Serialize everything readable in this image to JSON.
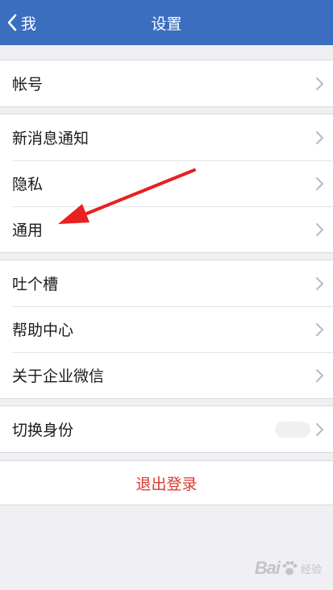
{
  "navbar": {
    "back_label": "我",
    "title": "设置"
  },
  "sections": [
    {
      "items": [
        {
          "label": "帐号"
        }
      ]
    },
    {
      "items": [
        {
          "label": "新消息通知"
        },
        {
          "label": "隐私"
        },
        {
          "label": "通用"
        }
      ]
    },
    {
      "items": [
        {
          "label": "吐个槽"
        },
        {
          "label": "帮助中心"
        },
        {
          "label": "关于企业微信"
        }
      ]
    },
    {
      "items": [
        {
          "label": "切换身份"
        }
      ]
    }
  ],
  "logout": {
    "label": "退出登录"
  },
  "watermark": {
    "text_a": "Bai",
    "text_b": "经验"
  },
  "colors": {
    "navbar": "#3c6ebf",
    "logout_text": "#e0352b",
    "annotation_arrow": "#e8201f",
    "background": "#efeff4"
  }
}
